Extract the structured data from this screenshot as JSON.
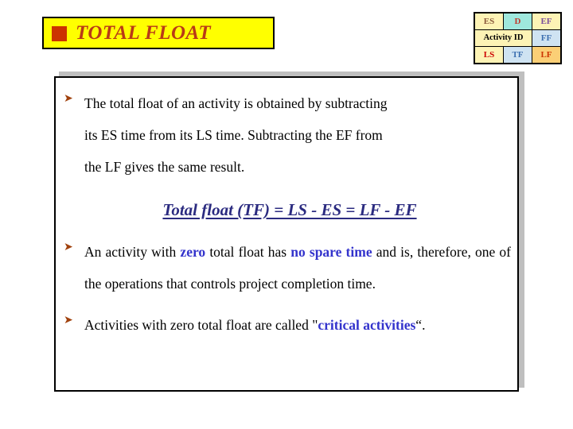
{
  "slide": {
    "title": {
      "text": "TOTAL FLOAT",
      "bullet_icon": "red-square-bullet",
      "background_color": "#ffff00",
      "text_color": "#b93b16",
      "border_color": "#000000"
    },
    "legend_table": {
      "name": "activity-node-legend",
      "rows": [
        [
          {
            "label": "ES",
            "bg": "#fdf3b5",
            "fg": "#8a5a3c"
          },
          {
            "label": "D",
            "bg": "#9fe8dd",
            "fg": "#c0392b"
          },
          {
            "label": "EF",
            "bg": "#fdf3b5",
            "fg": "#7b4f9d"
          }
        ],
        [
          {
            "label": "Activity ID",
            "bg": "#fdf3b5",
            "fg": "#000000",
            "colspan": 2
          },
          {
            "label": "FF",
            "bg": "#cfe3f2",
            "fg": "#3c6fb0"
          }
        ],
        [
          {
            "label": "LS",
            "bg": "#fdf3b5",
            "fg": "#cc0000"
          },
          {
            "label": "TF",
            "bg": "#cfe3f2",
            "fg": "#3c6fb0"
          },
          {
            "label": "LF",
            "bg": "#fbcf76",
            "fg": "#cc3300"
          }
        ]
      ]
    },
    "content": {
      "bullet_icon": "arrow-bullet",
      "bullets": [
        {
          "id": "bullet-total-float-definition",
          "lines": [
            "The total float of an activity is obtained by subtracting",
            "its ES time from its LS time. Subtracting the EF from",
            "the LF gives the same result."
          ]
        },
        {
          "id": "bullet-zero-float",
          "segments": [
            {
              "text": " An activity with ",
              "style": "normal"
            },
            {
              "text": "zero",
              "style": "highlight"
            },
            {
              "text": " total float has ",
              "style": "normal"
            },
            {
              "text": "no spare time",
              "style": "highlight"
            },
            {
              "text": " and is, therefore, one of the operations that controls project completion time.",
              "style": "normal"
            }
          ],
          "lines": [
            " An activity with zero total float has no spare time and",
            "is, therefore, one of the operations that controls project",
            "completion time."
          ]
        },
        {
          "id": "bullet-critical-activities",
          "segments": [
            {
              "text": " Activities with zero total float are called \"",
              "style": "normal"
            },
            {
              "text": "critical activities",
              "style": "highlight"
            },
            {
              "text": "“.",
              "style": "normal"
            }
          ],
          "lines": [
            " Activities with zero total float are called \"critical",
            "activities“."
          ]
        }
      ],
      "formula": {
        "text": "Total float (TF) = LS - ES = LF - EF",
        "color": "#2b2b80"
      },
      "border_color": "#000000",
      "shadow_color": "#bfbfbf"
    }
  }
}
